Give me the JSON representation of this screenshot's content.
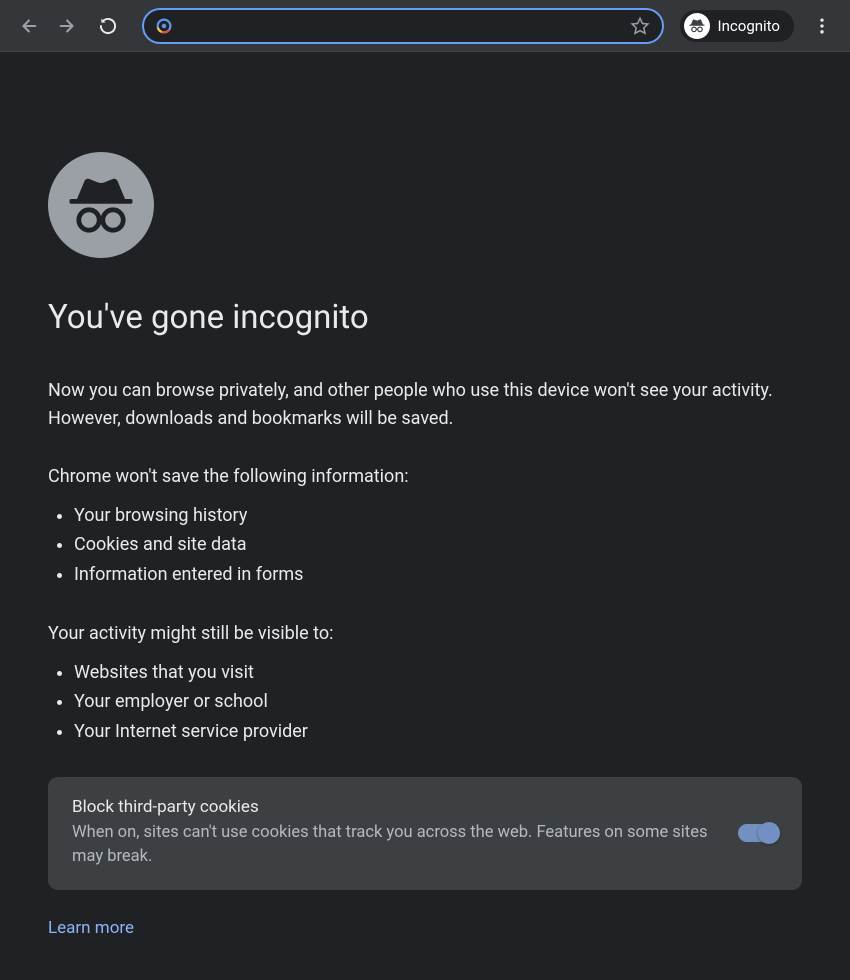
{
  "toolbar": {
    "incognito_label": "Incognito"
  },
  "page": {
    "heading": "You've gone incognito",
    "intro": "Now you can browse privately, and other people who use this device won't see your activity. However, downloads and bookmarks will be saved.",
    "wont_save_label": "Chrome won't save the following information:",
    "wont_save_items": [
      "Your browsing history",
      "Cookies and site data",
      "Information entered in forms"
    ],
    "visible_label": "Your activity might still be visible to:",
    "visible_items": [
      "Websites that you visit",
      "Your employer or school",
      "Your Internet service provider"
    ],
    "cookie_card": {
      "title": "Block third-party cookies",
      "desc": "When on, sites can't use cookies that track you across the web. Features on some sites may break.",
      "toggled": true
    },
    "learn_more": "Learn more"
  }
}
